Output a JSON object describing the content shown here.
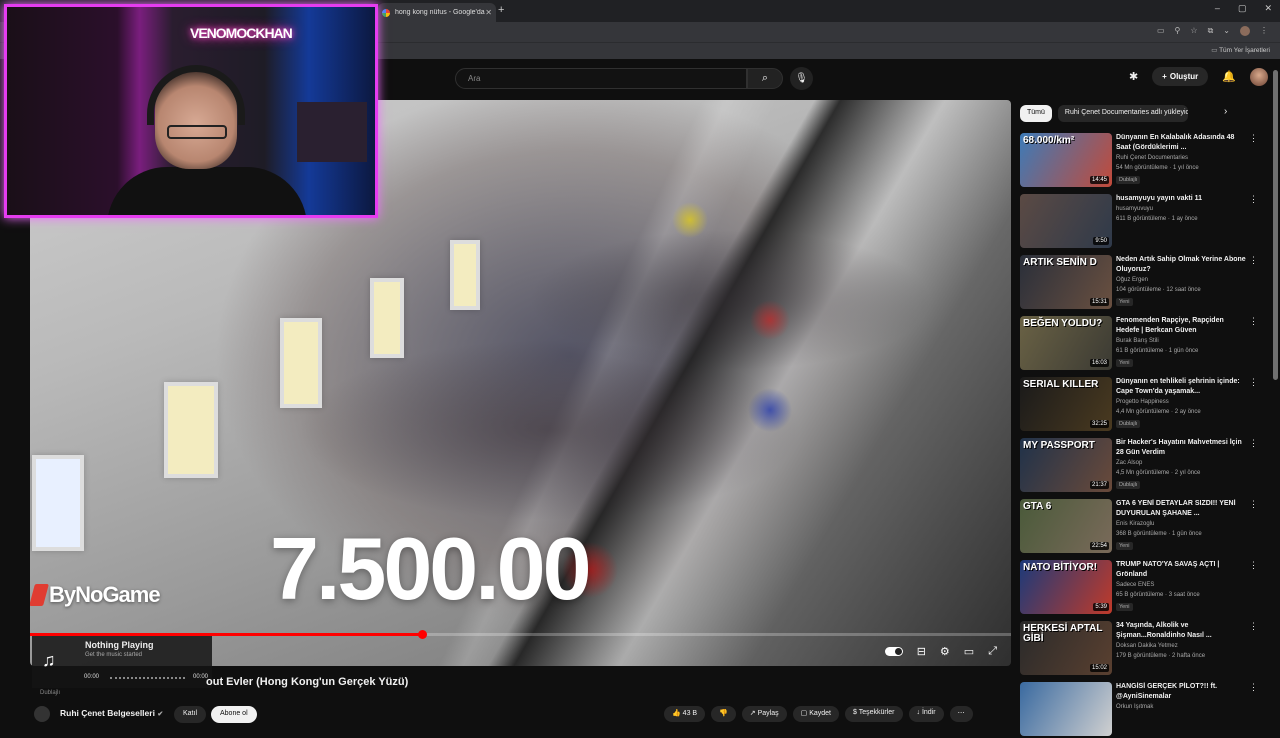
{
  "browser": {
    "tab_title": "hong kong nüfus - Google'da A",
    "new_tab": "+",
    "window_controls": [
      "–",
      "▢",
      "✕"
    ],
    "bookmarks_label": "Tüm Yer İşaretleri"
  },
  "youtube": {
    "search_placeholder": "Ara",
    "create_label": "Oluştur"
  },
  "player": {
    "overlay_number": "7.500.00",
    "channel_watermark": "ByNoGame",
    "progress_fraction": 0.4
  },
  "webcam": {
    "neon_sign": "VENOMOCKHAN"
  },
  "music_widget": {
    "title": "Nothing Playing",
    "subtitle": "Get the music started",
    "time_left": "00:00",
    "time_right": "00:00"
  },
  "video": {
    "title": "out Evler (Hong Kong'un Gerçek Yüzü)",
    "dublaj_tag": "Dublajlı",
    "channel_name": "Ruhi Çenet Belgeselleri",
    "join_label": "Katıl",
    "subscribe_label": "Abone ol",
    "actions": {
      "likes": "43 B",
      "share": "Paylaş",
      "save": "Kaydet",
      "thanks": "Teşekkürler",
      "download": "İndir",
      "more": "⋯"
    }
  },
  "sidebar": {
    "chips": [
      "Tümü",
      "Ruhi Çenet Documentaries adlı yükleyiciden"
    ],
    "recommendations": [
      {
        "title": "Dünyanın En Kalabalık Adasında 48 Saat (Gördüklerimi ...",
        "channel": "Ruhi Çenet Documentaries",
        "meta": "54 Mn görüntüleme · 1 yıl önce",
        "badge": "Dublajlı",
        "duration": "14:45",
        "thumb_text": "68.000/km²",
        "colors": [
          "#3d7bb8",
          "#c24a3a"
        ]
      },
      {
        "title": "husamyuyu yayın vakti 11",
        "channel": "husamyuvuyu",
        "meta": "611 B görüntüleme · 1 ay önce",
        "badge": "",
        "duration": "9:50",
        "thumb_text": "",
        "colors": [
          "#5b4a44",
          "#2f3a4a"
        ]
      },
      {
        "title": "Neden Artık Sahip Olmak Yerine Abone Oluyoruz?",
        "channel": "Oğuz Ergen",
        "meta": "104 görüntüleme · 12 saat önce",
        "badge": "Yeni",
        "duration": "15:31",
        "thumb_text": "ARTIK SENİN D",
        "colors": [
          "#2a2f3a",
          "#6a5040"
        ]
      },
      {
        "title": "Fenomenden Rapçiye, Rapçiden Hedefe | Berkcan Güven",
        "channel": "Burak Barış Stili",
        "meta": "61 B görüntüleme · 1 gün önce",
        "badge": "Yeni",
        "duration": "16:03",
        "thumb_text": "BEĞEN YOLDU?",
        "colors": [
          "#6a6245",
          "#3b3a33"
        ]
      },
      {
        "title": "Dünyanın en tehlikeli şehrinin içinde: Cape Town'da yaşamak...",
        "channel": "Progetto Happiness",
        "meta": "4,4 Mn görüntüleme · 2 ay önce",
        "badge": "Dublajlı",
        "duration": "32:25",
        "thumb_text": "SERIAL KILLER",
        "colors": [
          "#1a1a1a",
          "#4a3a20"
        ]
      },
      {
        "title": "Bir Hacker's Hayatını Mahvetmesi İçin 28 Gün Verdim",
        "channel": "Zac Alsop",
        "meta": "4,5 Mn görüntüleme · 2 yıl önce",
        "badge": "Dublajlı",
        "duration": "21:37",
        "thumb_text": "MY PASSPORT",
        "colors": [
          "#20324a",
          "#6a4a3a"
        ]
      },
      {
        "title": "GTA 6 YENİ DETAYLAR SIZDI!! YENİ DUYURULAN ŞAHANE ...",
        "channel": "Enis Kirazoglu",
        "meta": "368 B görüntüleme · 1 gün önce",
        "badge": "Yeni",
        "duration": "22:54",
        "thumb_text": "GTA 6",
        "colors": [
          "#4a5a3a",
          "#7a6a5a"
        ]
      },
      {
        "title": "TRUMP NATO'YA SAVAŞ AÇTI | Grönland",
        "channel": "Sadece ENES",
        "meta": "65 B görüntüleme · 3 saat önce",
        "badge": "Yeni",
        "duration": "5:39",
        "thumb_text": "NATO BİTİYOR!",
        "colors": [
          "#1c3a7a",
          "#c03a2a"
        ]
      },
      {
        "title": "34 Yaşında, Alkolik ve Şişman...Ronaldinho Nasıl ...",
        "channel": "Doksan Dakika Yetmez",
        "meta": "179 B görüntüleme · 2 hafta önce",
        "badge": "",
        "duration": "15:02",
        "thumb_text": "HERKESİ APTAL GİBİ",
        "colors": [
          "#2a2a2a",
          "#5a4030"
        ]
      },
      {
        "title": "HANGİSİ GERÇEK PİLOT?!! ft. @AyniSinemalar",
        "channel": "Orkun Işıtmak",
        "meta": "",
        "badge": "",
        "duration": "",
        "thumb_text": "",
        "colors": [
          "#3a6aa0",
          "#d0d0d0"
        ]
      }
    ]
  }
}
